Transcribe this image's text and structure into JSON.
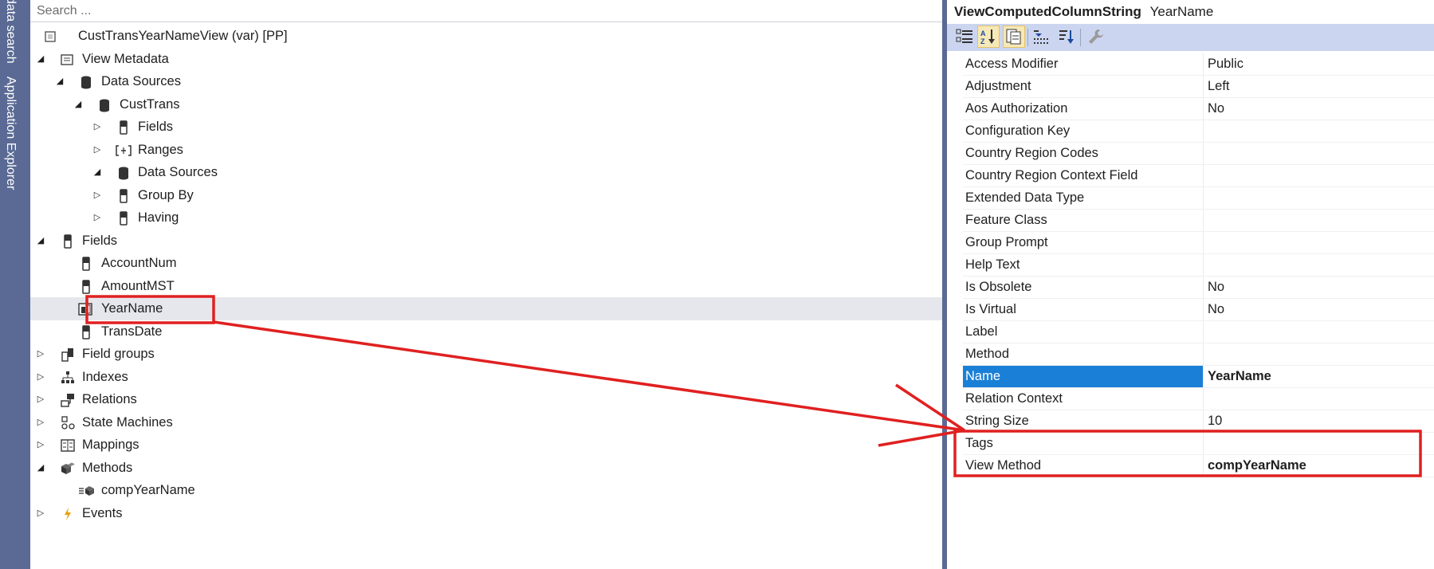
{
  "side_tabs": [
    "data search",
    "Application Explorer"
  ],
  "search": {
    "placeholder": "Search ..."
  },
  "tree": {
    "root_label": "CustTransYearNameView (var) [PP]",
    "view_metadata": "View Metadata",
    "data_sources": "Data Sources",
    "custtrans": "CustTrans",
    "ct_fields": "Fields",
    "ct_ranges": "Ranges",
    "ct_data_sources": "Data Sources",
    "ct_group_by": "Group By",
    "ct_having": "Having",
    "fields": "Fields",
    "f_accountnum": "AccountNum",
    "f_amountmst": "AmountMST",
    "f_yearname": "YearName",
    "f_transdate": "TransDate",
    "field_groups": "Field groups",
    "indexes": "Indexes",
    "relations": "Relations",
    "state_machines": "State Machines",
    "mappings": "Mappings",
    "methods": "Methods",
    "m_compyearname": "compYearName",
    "events": "Events"
  },
  "properties": {
    "type": "ViewComputedColumnString",
    "object_name": "YearName",
    "rows": [
      {
        "name": "Access Modifier",
        "value": "Public"
      },
      {
        "name": "Adjustment",
        "value": "Left"
      },
      {
        "name": "Aos Authorization",
        "value": "No"
      },
      {
        "name": "Configuration Key",
        "value": ""
      },
      {
        "name": "Country Region Codes",
        "value": ""
      },
      {
        "name": "Country Region Context Field",
        "value": ""
      },
      {
        "name": "Extended Data Type",
        "value": ""
      },
      {
        "name": "Feature Class",
        "value": ""
      },
      {
        "name": "Group Prompt",
        "value": ""
      },
      {
        "name": "Help Text",
        "value": ""
      },
      {
        "name": "Is Obsolete",
        "value": "No"
      },
      {
        "name": "Is Virtual",
        "value": "No"
      },
      {
        "name": "Label",
        "value": ""
      },
      {
        "name": "Method",
        "value": ""
      },
      {
        "name": "Name",
        "value": "YearName"
      },
      {
        "name": "Relation Context",
        "value": ""
      },
      {
        "name": "String Size",
        "value": "10"
      },
      {
        "name": "Tags",
        "value": ""
      },
      {
        "name": "View Method",
        "value": "compYearName"
      }
    ]
  },
  "colors": {
    "frame": "#5a6a94",
    "toolbar": "#ccd5f0",
    "selection": "#1a7fd6",
    "annotation": "#e02020"
  }
}
